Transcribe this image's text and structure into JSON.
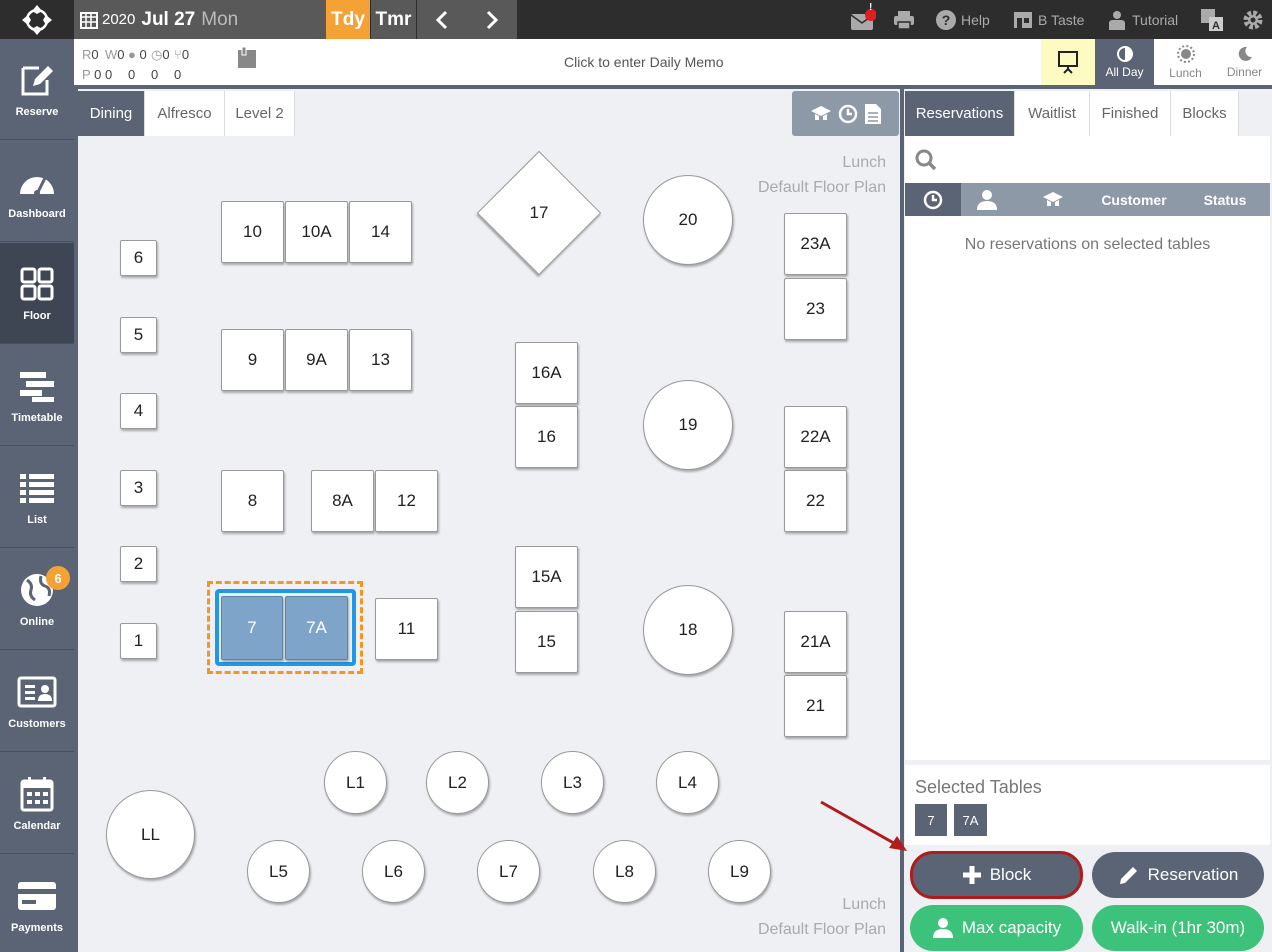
{
  "topbar": {
    "year": "2020",
    "month_day": "Jul 27",
    "weekday": "Mon",
    "today_label": "Tdy",
    "tomorrow_label": "Tmr",
    "help_label": "Help",
    "venue_label": "B Taste",
    "tutorial_label": "Tutorial",
    "mail_alert": "!"
  },
  "sidebar": {
    "items": [
      {
        "label": "Reserve"
      },
      {
        "label": "Dashboard"
      },
      {
        "label": "Floor"
      },
      {
        "label": "Timetable"
      },
      {
        "label": "List"
      },
      {
        "label": "Online",
        "badge": "6"
      },
      {
        "label": "Customers"
      },
      {
        "label": "Calendar"
      },
      {
        "label": "Payments"
      }
    ]
  },
  "infobar": {
    "counts_row1": [
      {
        "label": "R",
        "value": "0"
      },
      {
        "label": "W",
        "value": "0"
      },
      {
        "label": "",
        "value": "0"
      },
      {
        "label": "",
        "value": "0"
      },
      {
        "label": "",
        "value": "0"
      }
    ],
    "counts_row2": [
      {
        "label": "P",
        "value": "0"
      },
      {
        "label": "",
        "value": "0"
      },
      {
        "label": "",
        "value": "0"
      },
      {
        "label": "",
        "value": "0"
      },
      {
        "label": "",
        "value": "0"
      }
    ],
    "memo_placeholder": "Click to enter Daily Memo",
    "periods": [
      "All Day",
      "Lunch",
      "Dinner"
    ]
  },
  "floor": {
    "tabs": [
      "Dining",
      "Alfresco",
      "Level 2"
    ],
    "plan_name_top": [
      "Lunch",
      "Default Floor Plan"
    ],
    "plan_name_bottom": [
      "Lunch",
      "Default Floor Plan"
    ],
    "tables": {
      "t6": "6",
      "t5": "5",
      "t4": "4",
      "t3": "3",
      "t2": "2",
      "t1": "1",
      "t10": "10",
      "t10a": "10A",
      "t14": "14",
      "t9": "9",
      "t9a": "9A",
      "t13": "13",
      "t8": "8",
      "t8a": "8A",
      "t12": "12",
      "t7": "7",
      "t7a": "7A",
      "t11": "11",
      "t17": "17",
      "t16a": "16A",
      "t16": "16",
      "t15a": "15A",
      "t15": "15",
      "t20": "20",
      "t19": "19",
      "t18": "18",
      "t23a": "23A",
      "t23": "23",
      "t22a": "22A",
      "t22": "22",
      "t21a": "21A",
      "t21": "21",
      "tl1": "L1",
      "tl2": "L2",
      "tl3": "L3",
      "tl4": "L4",
      "tll": "LL",
      "tl5": "L5",
      "tl6": "L6",
      "tl7": "L7",
      "tl8": "L8",
      "tl9": "L9"
    }
  },
  "rpanel": {
    "tabs": [
      "Reservations",
      "Waitlist",
      "Finished",
      "Blocks"
    ],
    "columns": {
      "customer": "Customer",
      "status": "Status"
    },
    "empty_message": "No reservations on selected tables",
    "selected_title": "Selected Tables",
    "selected_tables": [
      "7",
      "7A"
    ],
    "actions": {
      "block": "Block",
      "reservation": "Reservation",
      "max_capacity": "Max capacity",
      "walkin": "Walk-in (1hr 30m)"
    }
  },
  "colors": {
    "accent": "#f4a235",
    "slate": "#5a6474",
    "green": "#3cc27a",
    "selected": "#7ea5c9",
    "highlight": "#b01c1c"
  }
}
